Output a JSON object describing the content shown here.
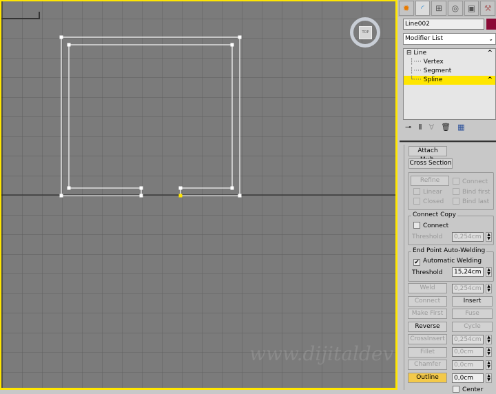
{
  "viewport": {
    "label": "Top",
    "viewcube": {
      "face": "TOP"
    },
    "watermark": "www.dijitaldev",
    "border_color": "#ffe600",
    "selected_vertex_color": "#ffe600"
  },
  "panel": {
    "tabs": [
      {
        "icon": "create-icon"
      },
      {
        "icon": "modify-icon",
        "active": true
      },
      {
        "icon": "hierarchy-icon"
      },
      {
        "icon": "motion-icon"
      },
      {
        "icon": "display-icon"
      },
      {
        "icon": "utilities-icon"
      }
    ],
    "object_name": "Line002",
    "object_color": "#8b0a36",
    "modifier_list": "Modifier List",
    "stack": [
      {
        "label": "Line"
      },
      {
        "label": "Vertex"
      },
      {
        "label": "Segment"
      },
      {
        "label": "Spline",
        "selected": true
      }
    ],
    "stack_tools": [
      {
        "icon": "pin-stack-icon"
      },
      {
        "icon": "show-end-result-icon"
      },
      {
        "icon": "make-unique-icon"
      },
      {
        "icon": "remove-modifier-icon"
      },
      {
        "icon": "configure-sets-icon"
      }
    ],
    "geometry": {
      "attach_mult": "Attach Mult.",
      "cross_section": "Cross Section",
      "refine": "Refine",
      "connect": "Connect",
      "linear": "Linear",
      "bind_first": "Bind first",
      "closed": "Closed",
      "bind_last": "Bind last",
      "connect_copy": {
        "title": "Connect Copy",
        "connect": "Connect",
        "threshold_label": "Threshold",
        "threshold": "0,254cm"
      },
      "auto_weld": {
        "title": "End Point Auto-Welding",
        "automatic": "Automatic Welding",
        "automatic_checked": true,
        "threshold_label": "Threshold",
        "threshold": "15,24cm"
      },
      "weld": "Weld",
      "weld_value": "0,254cm",
      "connect_btn": "Connect",
      "insert": "Insert",
      "make_first": "Make First",
      "fuse": "Fuse",
      "reverse": "Reverse",
      "cycle": "Cycle",
      "cross_insert": "CrossInsert",
      "cross_insert_value": "0,254cm",
      "fillet": "Fillet",
      "fillet_value": "0,0cm",
      "chamfer": "Chamfer",
      "chamfer_value": "0,0cm",
      "outline": "Outline",
      "outline_value": "0,0cm",
      "outline_active": true,
      "center": "Center"
    }
  }
}
